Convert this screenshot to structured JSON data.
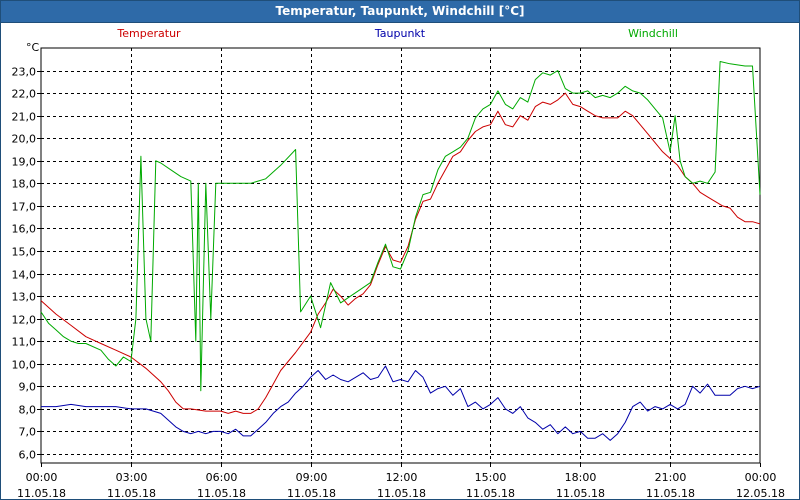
{
  "window": {
    "title": "Temperatur, Taupunkt, Windchill [°C]"
  },
  "chart_data": {
    "type": "line",
    "title": "Temperatur, Taupunkt, Windchill [°C]",
    "ylabel": "°C",
    "ylim": [
      5.6,
      24.0
    ],
    "xlim": [
      "11.05.18 00:00",
      "12.05.18 00:00"
    ],
    "yticks": [
      6.0,
      7.0,
      8.0,
      9.0,
      10.0,
      11.0,
      12.0,
      13.0,
      14.0,
      15.0,
      16.0,
      17.0,
      18.0,
      19.0,
      20.0,
      21.0,
      22.0,
      23.0
    ],
    "xticks": [
      {
        "time": "00:00",
        "date": "11.05.18"
      },
      {
        "time": "03:00",
        "date": "11.05.18"
      },
      {
        "time": "06:00",
        "date": "11.05.18"
      },
      {
        "time": "09:00",
        "date": "11.05.18"
      },
      {
        "time": "12:00",
        "date": "11.05.18"
      },
      {
        "time": "15:00",
        "date": "11.05.18"
      },
      {
        "time": "18:00",
        "date": "11.05.18"
      },
      {
        "time": "21:00",
        "date": "11.05.18"
      },
      {
        "time": "00:00",
        "date": "12.05.18"
      }
    ],
    "grid": true,
    "legend_position": "top",
    "series": [
      {
        "name": "Temperatur",
        "color": "#cc0000",
        "points": [
          [
            "00:00",
            12.8
          ],
          [
            "00:30",
            12.2
          ],
          [
            "01:00",
            11.7
          ],
          [
            "01:30",
            11.2
          ],
          [
            "02:00",
            10.9
          ],
          [
            "02:30",
            10.6
          ],
          [
            "03:00",
            10.3
          ],
          [
            "03:30",
            9.8
          ],
          [
            "04:00",
            9.2
          ],
          [
            "04:15",
            8.8
          ],
          [
            "04:30",
            8.3
          ],
          [
            "04:45",
            8.0
          ],
          [
            "05:00",
            8.0
          ],
          [
            "05:30",
            7.9
          ],
          [
            "06:00",
            7.9
          ],
          [
            "06:15",
            7.8
          ],
          [
            "06:30",
            7.9
          ],
          [
            "06:45",
            7.8
          ],
          [
            "07:00",
            7.8
          ],
          [
            "07:15",
            8.0
          ],
          [
            "07:30",
            8.5
          ],
          [
            "07:45",
            9.1
          ],
          [
            "08:00",
            9.7
          ],
          [
            "08:30",
            10.5
          ],
          [
            "09:00",
            11.4
          ],
          [
            "09:15",
            12.2
          ],
          [
            "09:30",
            12.7
          ],
          [
            "09:45",
            13.3
          ],
          [
            "10:00",
            13.0
          ],
          [
            "10:15",
            12.6
          ],
          [
            "10:30",
            12.9
          ],
          [
            "10:45",
            13.1
          ],
          [
            "11:00",
            13.5
          ],
          [
            "11:15",
            14.4
          ],
          [
            "11:30",
            15.2
          ],
          [
            "11:45",
            14.6
          ],
          [
            "12:00",
            14.5
          ],
          [
            "12:15",
            15.2
          ],
          [
            "12:30",
            16.4
          ],
          [
            "12:45",
            17.2
          ],
          [
            "13:00",
            17.3
          ],
          [
            "13:15",
            18.0
          ],
          [
            "13:30",
            18.6
          ],
          [
            "13:45",
            19.2
          ],
          [
            "14:00",
            19.4
          ],
          [
            "14:15",
            19.9
          ],
          [
            "14:30",
            20.3
          ],
          [
            "14:45",
            20.5
          ],
          [
            "15:00",
            20.6
          ],
          [
            "15:15",
            21.2
          ],
          [
            "15:30",
            20.6
          ],
          [
            "15:45",
            20.5
          ],
          [
            "16:00",
            21.0
          ],
          [
            "16:15",
            20.8
          ],
          [
            "16:30",
            21.4
          ],
          [
            "16:45",
            21.6
          ],
          [
            "17:00",
            21.5
          ],
          [
            "17:15",
            21.7
          ],
          [
            "17:30",
            22.0
          ],
          [
            "17:45",
            21.5
          ],
          [
            "18:00",
            21.4
          ],
          [
            "18:15",
            21.2
          ],
          [
            "18:30",
            21.0
          ],
          [
            "18:45",
            20.9
          ],
          [
            "19:00",
            20.9
          ],
          [
            "19:15",
            20.9
          ],
          [
            "19:30",
            21.2
          ],
          [
            "19:45",
            21.0
          ],
          [
            "20:00",
            20.6
          ],
          [
            "20:15",
            20.2
          ],
          [
            "20:30",
            19.8
          ],
          [
            "20:45",
            19.4
          ],
          [
            "21:00",
            19.1
          ],
          [
            "21:15",
            18.8
          ],
          [
            "21:30",
            18.3
          ],
          [
            "21:45",
            18.0
          ],
          [
            "22:00",
            17.6
          ],
          [
            "22:15",
            17.4
          ],
          [
            "22:30",
            17.2
          ],
          [
            "22:45",
            17.0
          ],
          [
            "23:00",
            16.9
          ],
          [
            "23:15",
            16.5
          ],
          [
            "23:30",
            16.3
          ],
          [
            "23:45",
            16.3
          ],
          [
            "24:00",
            16.2
          ]
        ]
      },
      {
        "name": "Taupunkt",
        "color": "#0000aa",
        "points": [
          [
            "00:00",
            8.1
          ],
          [
            "00:30",
            8.1
          ],
          [
            "01:00",
            8.2
          ],
          [
            "01:30",
            8.1
          ],
          [
            "02:00",
            8.1
          ],
          [
            "02:30",
            8.1
          ],
          [
            "03:00",
            8.0
          ],
          [
            "03:30",
            8.0
          ],
          [
            "04:00",
            7.8
          ],
          [
            "04:15",
            7.5
          ],
          [
            "04:30",
            7.2
          ],
          [
            "04:45",
            7.0
          ],
          [
            "05:00",
            6.9
          ],
          [
            "05:15",
            7.0
          ],
          [
            "05:30",
            6.9
          ],
          [
            "05:45",
            7.0
          ],
          [
            "06:00",
            7.0
          ],
          [
            "06:15",
            6.9
          ],
          [
            "06:30",
            7.1
          ],
          [
            "06:45",
            6.8
          ],
          [
            "07:00",
            6.8
          ],
          [
            "07:15",
            7.1
          ],
          [
            "07:30",
            7.4
          ],
          [
            "07:45",
            7.8
          ],
          [
            "08:00",
            8.1
          ],
          [
            "08:15",
            8.3
          ],
          [
            "08:30",
            8.7
          ],
          [
            "08:45",
            9.0
          ],
          [
            "09:00",
            9.4
          ],
          [
            "09:15",
            9.7
          ],
          [
            "09:30",
            9.3
          ],
          [
            "09:45",
            9.5
          ],
          [
            "10:00",
            9.3
          ],
          [
            "10:15",
            9.2
          ],
          [
            "10:30",
            9.4
          ],
          [
            "10:45",
            9.6
          ],
          [
            "11:00",
            9.3
          ],
          [
            "11:15",
            9.4
          ],
          [
            "11:30",
            9.9
          ],
          [
            "11:45",
            9.2
          ],
          [
            "12:00",
            9.3
          ],
          [
            "12:15",
            9.2
          ],
          [
            "12:30",
            9.7
          ],
          [
            "12:45",
            9.4
          ],
          [
            "13:00",
            8.7
          ],
          [
            "13:15",
            8.9
          ],
          [
            "13:30",
            9.0
          ],
          [
            "13:45",
            8.6
          ],
          [
            "14:00",
            8.9
          ],
          [
            "14:15",
            8.1
          ],
          [
            "14:30",
            8.3
          ],
          [
            "14:45",
            8.0
          ],
          [
            "15:00",
            8.2
          ],
          [
            "15:15",
            8.5
          ],
          [
            "15:30",
            8.0
          ],
          [
            "15:45",
            7.8
          ],
          [
            "16:00",
            8.1
          ],
          [
            "16:15",
            7.6
          ],
          [
            "16:30",
            7.4
          ],
          [
            "16:45",
            7.1
          ],
          [
            "17:00",
            7.3
          ],
          [
            "17:15",
            6.9
          ],
          [
            "17:30",
            7.2
          ],
          [
            "17:45",
            6.9
          ],
          [
            "18:00",
            7.0
          ],
          [
            "18:15",
            6.7
          ],
          [
            "18:30",
            6.7
          ],
          [
            "18:45",
            6.9
          ],
          [
            "19:00",
            6.6
          ],
          [
            "19:15",
            6.9
          ],
          [
            "19:30",
            7.4
          ],
          [
            "19:45",
            8.1
          ],
          [
            "20:00",
            8.3
          ],
          [
            "20:15",
            7.9
          ],
          [
            "20:30",
            8.1
          ],
          [
            "20:45",
            8.0
          ],
          [
            "21:00",
            8.2
          ],
          [
            "21:15",
            8.0
          ],
          [
            "21:30",
            8.2
          ],
          [
            "21:45",
            9.0
          ],
          [
            "22:00",
            8.7
          ],
          [
            "22:15",
            9.1
          ],
          [
            "22:30",
            8.6
          ],
          [
            "22:45",
            8.6
          ],
          [
            "23:00",
            8.6
          ],
          [
            "23:15",
            8.9
          ],
          [
            "23:30",
            9.0
          ],
          [
            "23:45",
            8.9
          ],
          [
            "24:00",
            9.0
          ]
        ]
      },
      {
        "name": "Windchill",
        "color": "#00aa00",
        "points": [
          [
            "00:00",
            12.3
          ],
          [
            "00:15",
            11.8
          ],
          [
            "00:30",
            11.5
          ],
          [
            "00:45",
            11.2
          ],
          [
            "01:00",
            11.0
          ],
          [
            "01:15",
            10.9
          ],
          [
            "01:30",
            10.9
          ],
          [
            "02:00",
            10.6
          ],
          [
            "02:15",
            10.2
          ],
          [
            "02:30",
            9.9
          ],
          [
            "02:45",
            10.3
          ],
          [
            "03:00",
            10.1
          ],
          [
            "03:10",
            12.0
          ],
          [
            "03:20",
            19.2
          ],
          [
            "03:30",
            12.0
          ],
          [
            "03:40",
            11.0
          ],
          [
            "03:50",
            19.0
          ],
          [
            "04:00",
            18.9
          ],
          [
            "04:20",
            18.6
          ],
          [
            "04:40",
            18.3
          ],
          [
            "05:00",
            18.1
          ],
          [
            "05:10",
            11.0
          ],
          [
            "05:15",
            18.0
          ],
          [
            "05:20",
            8.8
          ],
          [
            "05:30",
            18.0
          ],
          [
            "05:40",
            12.0
          ],
          [
            "05:50",
            18.0
          ],
          [
            "06:00",
            18.0
          ],
          [
            "06:30",
            18.0
          ],
          [
            "07:00",
            18.0
          ],
          [
            "07:30",
            18.2
          ],
          [
            "08:00",
            18.8
          ],
          [
            "08:30",
            19.5
          ],
          [
            "08:40",
            12.3
          ],
          [
            "09:00",
            13.0
          ],
          [
            "09:20",
            11.6
          ],
          [
            "09:40",
            13.6
          ],
          [
            "10:00",
            12.7
          ],
          [
            "10:20",
            13.0
          ],
          [
            "10:40",
            13.3
          ],
          [
            "11:00",
            13.6
          ],
          [
            "11:15",
            14.5
          ],
          [
            "11:30",
            15.3
          ],
          [
            "11:45",
            14.3
          ],
          [
            "12:00",
            14.2
          ],
          [
            "12:15",
            15.0
          ],
          [
            "12:30",
            16.5
          ],
          [
            "12:45",
            17.5
          ],
          [
            "13:00",
            17.6
          ],
          [
            "13:15",
            18.6
          ],
          [
            "13:30",
            19.2
          ],
          [
            "13:45",
            19.4
          ],
          [
            "14:00",
            19.6
          ],
          [
            "14:15",
            20.0
          ],
          [
            "14:30",
            20.9
          ],
          [
            "14:45",
            21.3
          ],
          [
            "15:00",
            21.5
          ],
          [
            "15:15",
            22.1
          ],
          [
            "15:30",
            21.5
          ],
          [
            "15:45",
            21.3
          ],
          [
            "16:00",
            21.8
          ],
          [
            "16:15",
            21.6
          ],
          [
            "16:30",
            22.6
          ],
          [
            "16:45",
            22.9
          ],
          [
            "17:00",
            22.8
          ],
          [
            "17:15",
            23.0
          ],
          [
            "17:30",
            22.2
          ],
          [
            "17:45",
            22.0
          ],
          [
            "18:00",
            22.0
          ],
          [
            "18:15",
            22.1
          ],
          [
            "18:30",
            21.8
          ],
          [
            "18:45",
            21.9
          ],
          [
            "19:00",
            21.8
          ],
          [
            "19:15",
            22.0
          ],
          [
            "19:30",
            22.3
          ],
          [
            "19:45",
            22.1
          ],
          [
            "20:00",
            22.0
          ],
          [
            "20:15",
            21.7
          ],
          [
            "20:30",
            21.3
          ],
          [
            "20:45",
            20.9
          ],
          [
            "21:00",
            19.4
          ],
          [
            "21:10",
            21.0
          ],
          [
            "21:20",
            19.0
          ],
          [
            "21:30",
            18.3
          ],
          [
            "21:45",
            18.0
          ],
          [
            "22:00",
            18.1
          ],
          [
            "22:15",
            18.0
          ],
          [
            "22:30",
            18.5
          ],
          [
            "22:40",
            23.4
          ],
          [
            "23:00",
            23.3
          ],
          [
            "23:30",
            23.2
          ],
          [
            "23:45",
            23.2
          ],
          [
            "24:00",
            17.5
          ]
        ]
      }
    ]
  }
}
